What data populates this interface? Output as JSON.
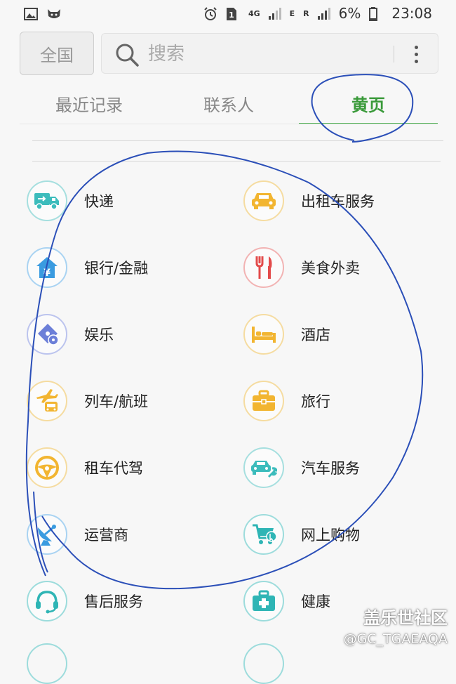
{
  "status_bar": {
    "net_label": "4G",
    "data_label": "E",
    "roam_label": "R",
    "battery": "6%",
    "time": "23:08"
  },
  "search": {
    "region_label": "全国",
    "placeholder": "搜索"
  },
  "tabs": [
    {
      "label": "最近记录",
      "active": false
    },
    {
      "label": "联系人",
      "active": false
    },
    {
      "label": "黄页",
      "active": true
    }
  ],
  "categories": [
    {
      "label": "快递",
      "icon": "delivery-truck-icon",
      "color": "#3cbcbc"
    },
    {
      "label": "出租车服务",
      "icon": "taxi-icon",
      "color": "#f2b531"
    },
    {
      "label": "银行/金融",
      "icon": "bank-icon",
      "color": "#3a9be0"
    },
    {
      "label": "美食外卖",
      "icon": "fork-knife-icon",
      "color": "#e34b4b"
    },
    {
      "label": "娱乐",
      "icon": "ticket-icon",
      "color": "#6c7fd8"
    },
    {
      "label": "酒店",
      "icon": "bed-icon",
      "color": "#f2b531"
    },
    {
      "label": "列车/航班",
      "icon": "plane-train-icon",
      "color": "#f2b531"
    },
    {
      "label": "旅行",
      "icon": "suitcase-icon",
      "color": "#f2b531"
    },
    {
      "label": "租车代驾",
      "icon": "steering-wheel-icon",
      "color": "#f2b531"
    },
    {
      "label": "汽车服务",
      "icon": "car-service-icon",
      "color": "#3cbcbc"
    },
    {
      "label": "运营商",
      "icon": "satellite-dish-icon",
      "color": "#3a9be0"
    },
    {
      "label": "网上购物",
      "icon": "shopping-cart-icon",
      "color": "#2fb5b5"
    },
    {
      "label": "售后服务",
      "icon": "headset-icon",
      "color": "#2fb5b5"
    },
    {
      "label": "健康",
      "icon": "medical-kit-icon",
      "color": "#2fb5b5"
    }
  ],
  "watermark": {
    "site": "盖乐世社区",
    "user": "@GC_TGAEAQA"
  }
}
